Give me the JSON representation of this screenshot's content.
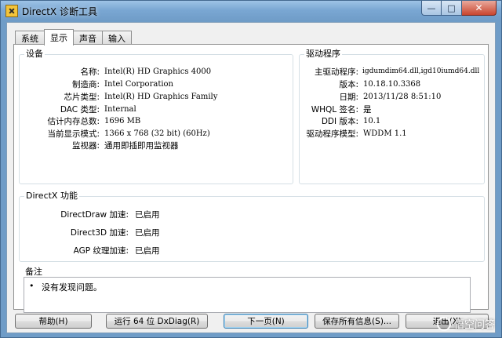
{
  "window": {
    "title": "DirectX 诊断工具",
    "buttons": {
      "minimize": "—",
      "maximize": "□",
      "close": "✕"
    }
  },
  "tabs": [
    {
      "label": "系统",
      "active": false
    },
    {
      "label": "显示",
      "active": true
    },
    {
      "label": "声音",
      "active": false
    },
    {
      "label": "输入",
      "active": false
    }
  ],
  "device": {
    "title": "设备",
    "rows": [
      {
        "label": "名称:",
        "value": "Intel(R) HD Graphics 4000"
      },
      {
        "label": "制造商:",
        "value": "Intel Corporation"
      },
      {
        "label": "芯片类型:",
        "value": "Intel(R) HD Graphics Family"
      },
      {
        "label": "DAC 类型:",
        "value": "Internal"
      },
      {
        "label": "估计内存总数:",
        "value": "1696 MB"
      },
      {
        "label": "当前显示模式:",
        "value": "1366 x 768 (32 bit) (60Hz)"
      },
      {
        "label": "监视器:",
        "value": "通用即插即用监视器"
      }
    ]
  },
  "driver": {
    "title": "驱动程序",
    "rows": [
      {
        "label": "主驱动程序:",
        "value": "igdumdim64.dll,igd10iumd64.dll"
      },
      {
        "label": "版本:",
        "value": "10.18.10.3368"
      },
      {
        "label": "日期:",
        "value": "2013/11/28 8:51:10"
      },
      {
        "label": "WHQL 签名:",
        "value": "是"
      },
      {
        "label": "DDI 版本:",
        "value": "10.1"
      },
      {
        "label": "驱动程序模型:",
        "value": "WDDM 1.1"
      }
    ]
  },
  "features": {
    "title": "DirectX 功能",
    "rows": [
      {
        "label": "DirectDraw 加速:",
        "value": "已启用"
      },
      {
        "label": "Direct3D 加速:",
        "value": "已启用"
      },
      {
        "label": "AGP 纹理加速:",
        "value": "已启用"
      }
    ]
  },
  "notes": {
    "title": "备注",
    "bullet": "•",
    "text": "没有发现问题。"
  },
  "footer": {
    "help": "帮助(H)",
    "run64": "运行 64 位 DxDiag(R)",
    "next": "下一页(N)",
    "save": "保存所有信息(S)...",
    "exit": "退出(X)"
  },
  "watermark": {
    "text": "悟空问答"
  }
}
